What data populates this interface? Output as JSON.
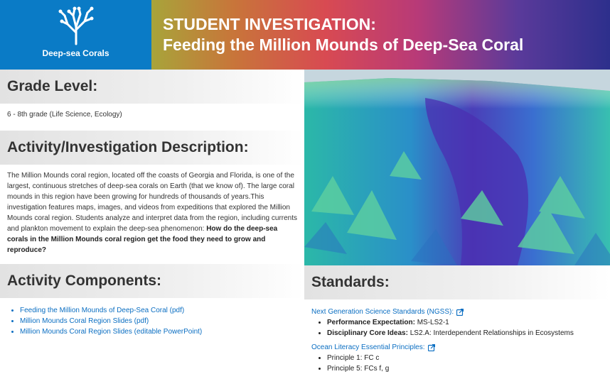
{
  "logo": {
    "label": "Deep-sea Corals"
  },
  "banner": {
    "title": "STUDENT INVESTIGATION:",
    "subtitle": "Feeding the Million Mounds of Deep-Sea Coral"
  },
  "grade": {
    "heading": "Grade Level:",
    "text": "6 - 8th grade (Life Science, Ecology)"
  },
  "description": {
    "heading": "Activity/Investigation Description:",
    "body": "The Million Mounds coral region, located off the coasts of Georgia and Florida, is one of the largest, continuous stretches of deep-sea corals on Earth (that we know of). The large coral mounds in this region have been growing for hundreds of thousands of years.This investigation features maps, images, and videos from expeditions that explored the Million Mounds coral region. Students analyze and interpret data from the region, including currents and plankton movement to explain the deep-sea phenomenon: ",
    "question": "How do the deep-sea corals in the Million Mounds coral region get the food they need to grow and reproduce?"
  },
  "components": {
    "heading": "Activity Components:",
    "items": [
      "Feeding the Million Mounds of Deep-Sea Coral (pdf)",
      "Million Mounds Coral Region Slides (pdf)",
      "Million Mounds Coral Region Slides (editable PowerPoint)"
    ]
  },
  "standards": {
    "heading": "Standards:",
    "ngss_link": "Next Generation Science Standards (NGSS):",
    "ngss_items": [
      {
        "label": "Performance Expectation:",
        "value": "MS-LS2-1"
      },
      {
        "label": "Disciplinary Core Ideas:",
        "value": "LS2.A: Interdependent Relationships in Ecosystems"
      }
    ],
    "ocean_link": "Ocean Literacy Essential Principles:",
    "ocean_items": [
      "Principle 1: FC c",
      "Principle 5: FCs f, g"
    ]
  },
  "icons": {
    "logo": "coral-icon",
    "external": "external-link-icon"
  },
  "colors": {
    "brand_blue": "#0a7bc6",
    "link": "#0a6ec2"
  }
}
